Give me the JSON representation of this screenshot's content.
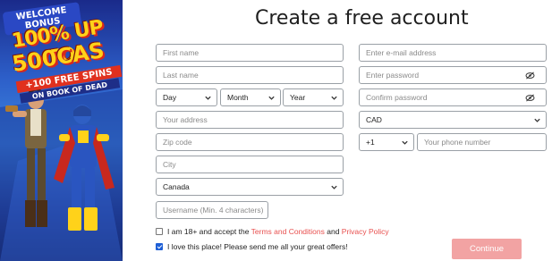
{
  "promo": {
    "line1": "WELCOME BONUS",
    "line2": "100% UP TO",
    "line3": "500CAS",
    "line4": "+100 FREE SPINS",
    "line5": "ON BOOK OF DEAD"
  },
  "form": {
    "title": "Create a free account",
    "first_name": "First name",
    "last_name": "Last name",
    "day": "Day",
    "month": "Month",
    "year": "Year",
    "address": "Your address",
    "zip": "Zip code",
    "city": "City",
    "country": "Canada",
    "username": "Username (Min. 4 characters)",
    "email": "Enter e-mail address",
    "password": "Enter password",
    "confirm_password": "Confirm password",
    "currency": "CAD",
    "phone_code": "+1",
    "phone": "Your phone number",
    "terms_prefix": "I am 18+ and accept the ",
    "terms_link": "Terms and Conditions",
    "terms_and": " and ",
    "privacy_link": "Privacy Policy",
    "newsletter": "I love this place! Please send me all your great offers!",
    "continue": "Continue"
  },
  "checkboxes": {
    "terms_checked": false,
    "newsletter_checked": true
  },
  "icons": {
    "password_toggle": "eye-slash-icon",
    "select_arrow": "chevron-down-icon"
  },
  "colors": {
    "accent_link": "#e8504f",
    "continue_bg": "#f2a3a3",
    "checkbox": "#1e5fd6"
  }
}
